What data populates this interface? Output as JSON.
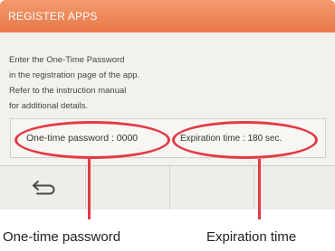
{
  "header": {
    "title": "REGISTER APPS"
  },
  "message": {
    "lines": [
      "Enter the One-Time Password",
      "in the registration page of the app.",
      "Refer to the instruction manual",
      "for additional details."
    ]
  },
  "info": {
    "password_text": "One-time password : 0000",
    "expiration_text": "Expiration time : 180 sec."
  },
  "toolbar": {
    "back_icon": "back-arrow-icon"
  },
  "callouts": {
    "password": "One-time password",
    "expiration": "Expiration time"
  },
  "colors": {
    "title_bar": "#ec8354",
    "highlight": "#e23a44",
    "screen_bg": "#f2f1ee"
  }
}
